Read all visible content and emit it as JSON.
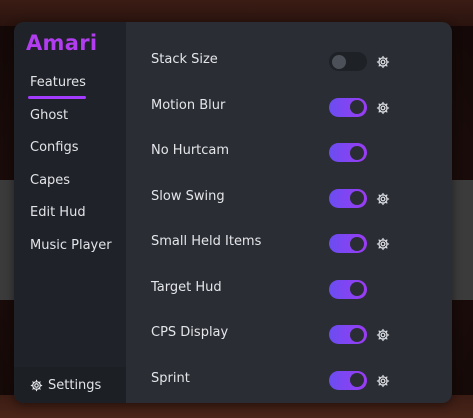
{
  "brand": "Amari",
  "nav": [
    {
      "label": "Features",
      "active": true
    },
    {
      "label": "Ghost"
    },
    {
      "label": "Configs"
    },
    {
      "label": "Capes"
    },
    {
      "label": "Edit Hud"
    },
    {
      "label": "Music Player"
    }
  ],
  "settings_label": "Settings",
  "colors": {
    "accent": "#a33cff",
    "brand": "#b23cf0",
    "toggle_on_start": "#6a4df0",
    "toggle_on_end": "#9b3cf5"
  },
  "features": [
    {
      "label": "Stack Size",
      "enabled": false,
      "has_settings": true
    },
    {
      "label": "Motion Blur",
      "enabled": true,
      "has_settings": true
    },
    {
      "label": "No Hurtcam",
      "enabled": true,
      "has_settings": false
    },
    {
      "label": "Slow Swing",
      "enabled": true,
      "has_settings": true
    },
    {
      "label": "Small Held Items",
      "enabled": true,
      "has_settings": true
    },
    {
      "label": "Target Hud",
      "enabled": true,
      "has_settings": false
    },
    {
      "label": "CPS Display",
      "enabled": true,
      "has_settings": true
    },
    {
      "label": "Sprint",
      "enabled": true,
      "has_settings": true
    }
  ],
  "icons": {
    "settings": "gear-icon",
    "feature_settings": "gear-icon"
  }
}
